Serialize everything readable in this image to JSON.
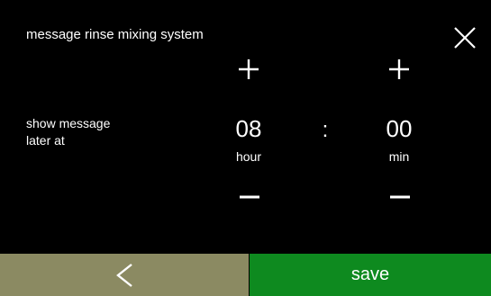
{
  "header": {
    "title": "message rinse mixing system"
  },
  "form": {
    "label": "show message\nlater at",
    "hour": {
      "value": "08",
      "unit": "hour"
    },
    "separator": ":",
    "minute": {
      "value": "00",
      "unit": "min"
    }
  },
  "footer": {
    "save_label": "save"
  },
  "colors": {
    "back_button": "#8b8a62",
    "save_button": "#0e8a1f",
    "background": "#000000"
  },
  "icons": [
    "close-icon",
    "plus-icon",
    "minus-icon",
    "chevron-left-icon"
  ]
}
